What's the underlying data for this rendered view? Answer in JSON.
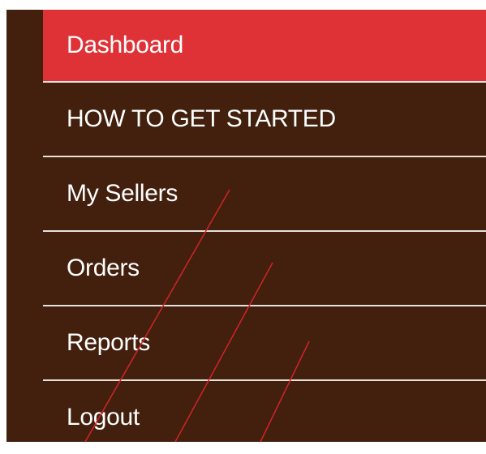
{
  "sidebar": {
    "items": [
      {
        "label": "Dashboard",
        "active": true
      },
      {
        "label": "HOW TO GET STARTED",
        "active": false
      },
      {
        "label": "My Sellers",
        "active": false
      },
      {
        "label": "Orders",
        "active": false
      },
      {
        "label": "Reports",
        "active": false
      },
      {
        "label": "Logout",
        "active": false
      }
    ]
  },
  "colors": {
    "sidebar_background": "#42200d",
    "active_item": "#df3237",
    "divider": "#e7e1db",
    "text": "#ffffff",
    "annotation_stroke": "#d3222a"
  }
}
